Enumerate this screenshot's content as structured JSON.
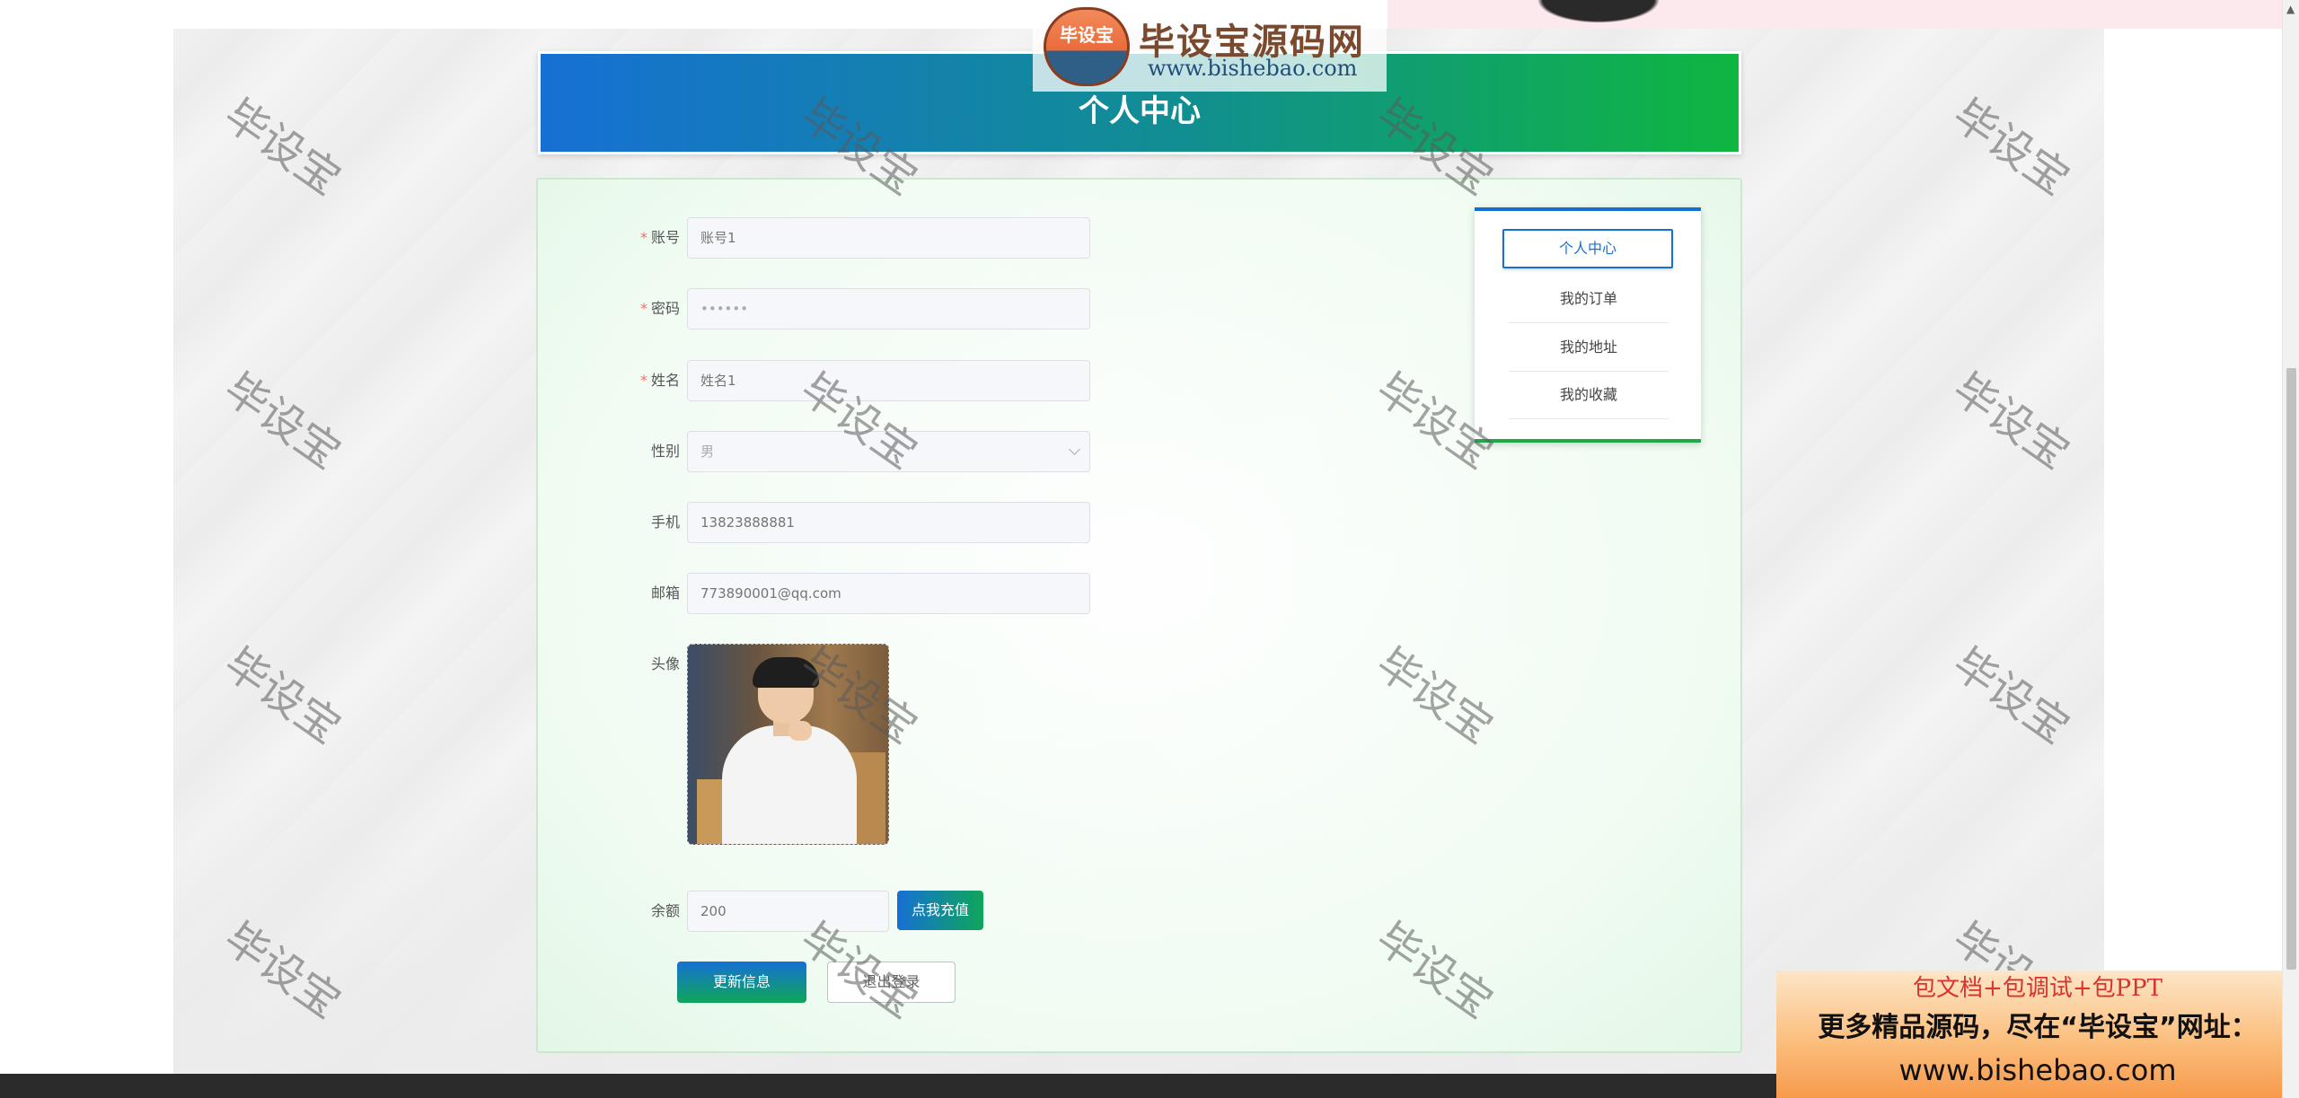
{
  "header": {
    "title": "个人中心"
  },
  "site_logo": {
    "icon_text": "毕设宝",
    "name": "毕设宝源码网",
    "url": "www.bishebao.com"
  },
  "watermark_text": "毕设宝",
  "form": {
    "account": {
      "label": "账号",
      "placeholder": "账号1",
      "required": true
    },
    "password": {
      "label": "密码",
      "value": "••••••",
      "required": true
    },
    "name": {
      "label": "姓名",
      "placeholder": "姓名1",
      "required": true
    },
    "gender": {
      "label": "性别",
      "value": "男"
    },
    "phone": {
      "label": "手机",
      "placeholder": "13823888881"
    },
    "email": {
      "label": "邮箱",
      "placeholder": "773890001@qq.com"
    },
    "avatar": {
      "label": "头像"
    },
    "balance": {
      "label": "余额",
      "placeholder": "200"
    }
  },
  "buttons": {
    "recharge": "点我充值",
    "update": "更新信息",
    "logout": "退出登录"
  },
  "menu": {
    "items": [
      "个人中心",
      "我的订单",
      "我的地址",
      "我的收藏"
    ],
    "active_index": 0
  },
  "promo": {
    "line1": "包文档+包调试+包PPT",
    "line2": "更多精品源码，尽在“毕设宝”网址：",
    "line3": "www.bishebao.com"
  },
  "colors": {
    "accent_blue": "#1670d4",
    "accent_green": "#0fb640",
    "required_mark": "#f56c6c"
  }
}
